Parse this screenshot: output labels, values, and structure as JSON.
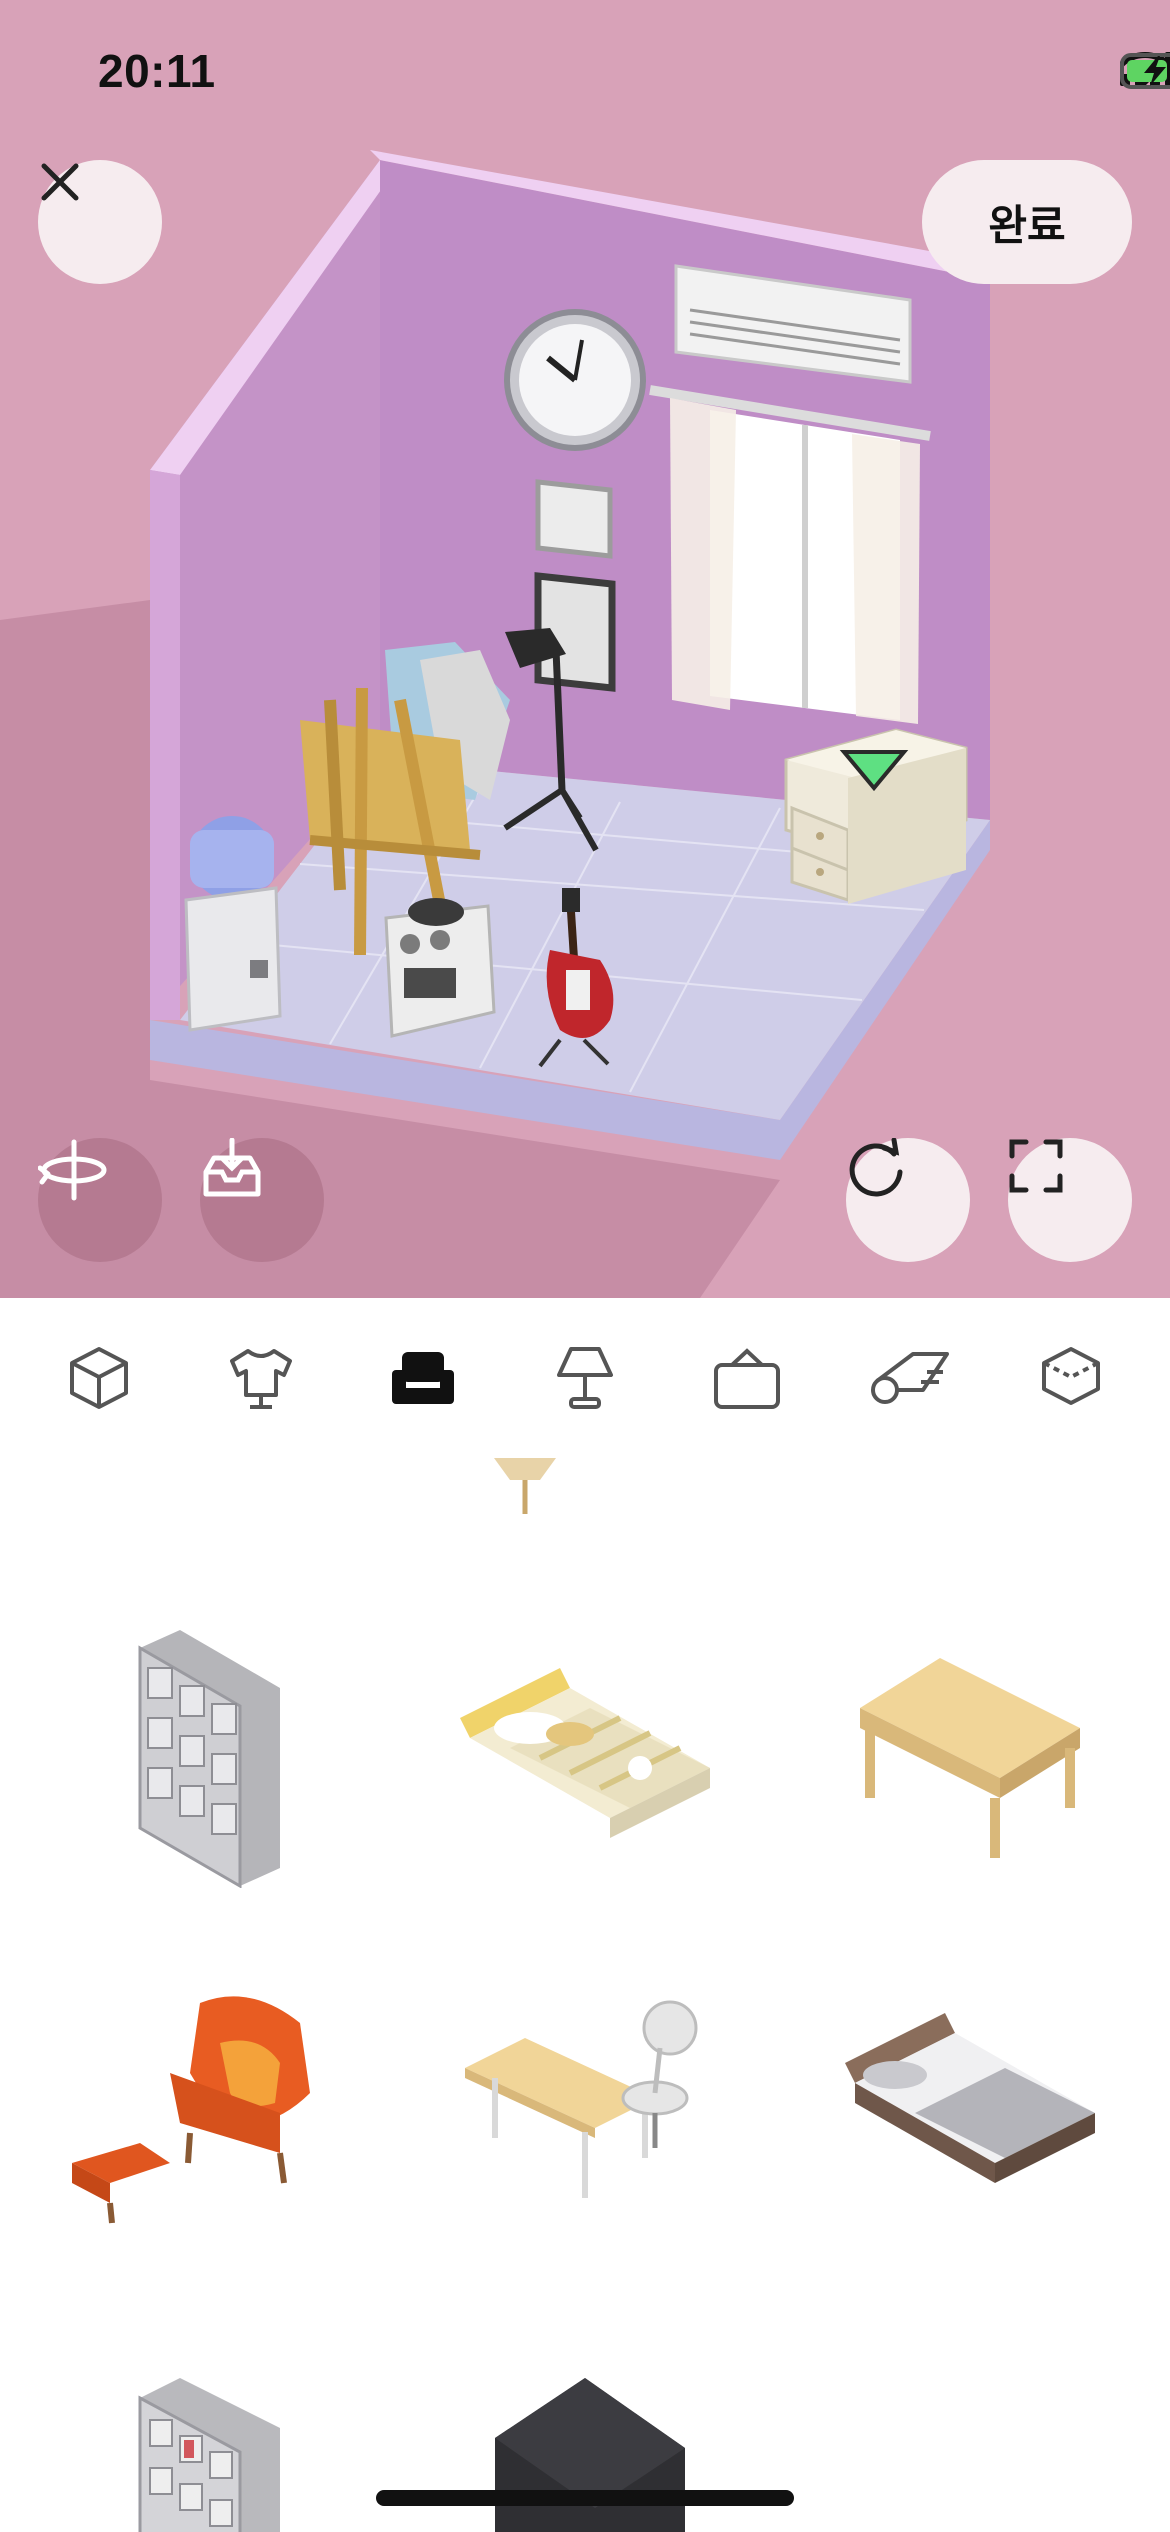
{
  "status_bar": {
    "time": "20:11"
  },
  "header": {
    "done_label": "완료"
  },
  "colors": {
    "scene_background": "#d8a2b8",
    "wall_left": "#c493c7",
    "wall_back": "#bf8dc6",
    "floor": "#cfcde8",
    "accent_marker": "#5ee082"
  },
  "scene_objects": [
    "wall-clock",
    "air-conditioner",
    "curtained-window",
    "picture-frame",
    "photo-frame",
    "floor-lamp",
    "easel",
    "water-dispenser",
    "espresso-machine",
    "electric-guitar",
    "nightstand"
  ],
  "tabs": [
    {
      "icon": "cube-icon",
      "selected": false
    },
    {
      "icon": "shirt-icon",
      "selected": false
    },
    {
      "icon": "armchair-icon",
      "selected": true
    },
    {
      "icon": "lamp-icon",
      "selected": false
    },
    {
      "icon": "frame-icon",
      "selected": false
    },
    {
      "icon": "rug-roll-icon",
      "selected": false
    },
    {
      "icon": "wallpaper-icon",
      "selected": false
    }
  ],
  "items": [
    {
      "icon": "filing-cabinet-icon"
    },
    {
      "icon": "yellow-bed-icon"
    },
    {
      "icon": "wood-table-icon"
    },
    {
      "icon": "orange-armchair-icon"
    },
    {
      "icon": "desk-chair-icon"
    },
    {
      "icon": "grey-bed-icon"
    },
    {
      "icon": "open-shelf-icon"
    },
    {
      "icon": "black-piano-icon"
    }
  ]
}
